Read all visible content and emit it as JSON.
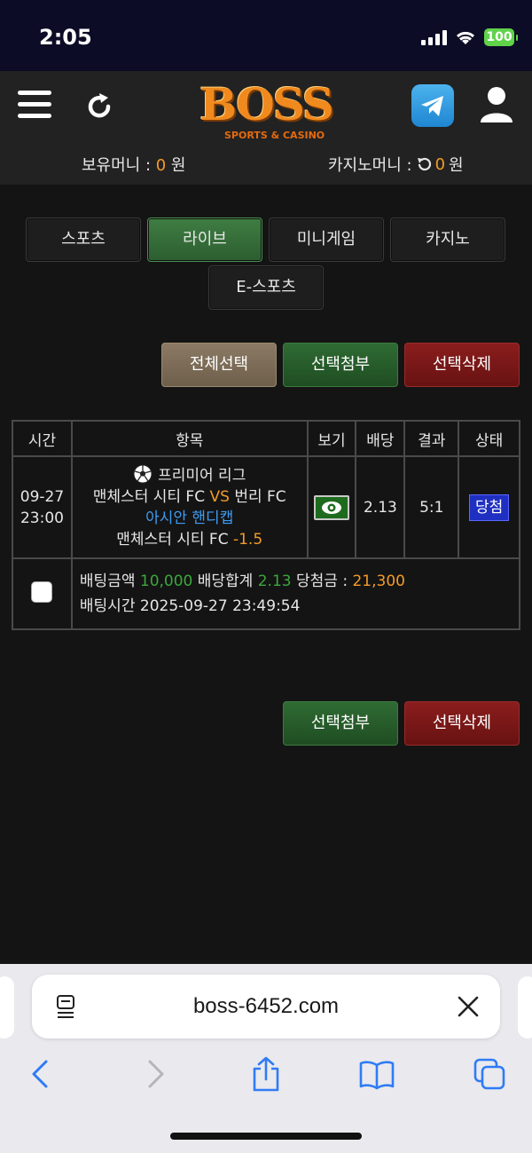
{
  "status_bar": {
    "time": "2:05",
    "battery": "100"
  },
  "header": {
    "logo_text": "BOSS",
    "logo_sub": "SPORTS & CASINO",
    "balance_label": "보유머니 : ",
    "balance_value": "0",
    "balance_unit": " 원",
    "casino_label": "카지노머니 : ",
    "casino_value": "0",
    "casino_unit": " 원"
  },
  "categories": [
    "스포츠",
    "라이브",
    "미니게임",
    "카지노",
    "E-스포츠"
  ],
  "active_category": "라이브",
  "actions": {
    "select_all": "전체선택",
    "attach_selected": "선택첨부",
    "delete_selected": "선택삭제"
  },
  "table": {
    "headers": [
      "시간",
      "항목",
      "보기",
      "배당",
      "결과",
      "상태"
    ],
    "bet": {
      "date": "09-27",
      "time": "23:00",
      "league": "프리미어 리그",
      "home": "맨체스터 시티 FC",
      "vs": "VS",
      "away": "번리 FC",
      "market": "아시안 핸디캡",
      "pick": "맨체스터 시티 FC",
      "pick_line": "-1.5",
      "odds": "2.13",
      "result": "5:1",
      "status": "당첨"
    },
    "summary": {
      "amount_label": "배팅금액",
      "amount": "10,000",
      "odds_label": "배당합계",
      "odds": "2.13",
      "win_label": "당첨금 :",
      "win": "21,300",
      "time_label": "배팅시간",
      "time": "2025-09-27 23:49:54"
    }
  },
  "browser": {
    "url": "boss-6452.com"
  },
  "colors": {
    "accent_orange": "#f29b2a",
    "green": "#3ba83b",
    "blue": "#3f9bf0",
    "status_blue": "#1f2fc2"
  }
}
